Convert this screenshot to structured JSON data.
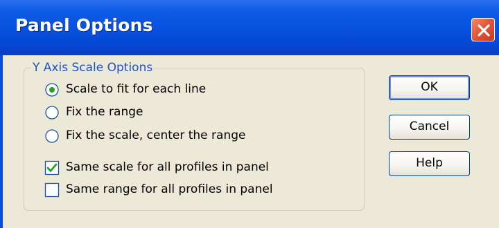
{
  "window": {
    "title": "Panel Options",
    "close_icon": "close-icon",
    "colors": {
      "titlebar": "#0449d8",
      "close": "#e2583a",
      "face": "#ece9d8",
      "group_label": "#1c51c9"
    }
  },
  "group": {
    "label": "Y Axis Scale Options",
    "radios": [
      {
        "label": "Scale to fit for each line",
        "selected": true
      },
      {
        "label": "Fix the range",
        "selected": false
      },
      {
        "label": "Fix the scale, center the range",
        "selected": false
      }
    ],
    "checkboxes": [
      {
        "label": "Same scale for all profiles in panel",
        "checked": true
      },
      {
        "label": "Same range for all profiles in panel",
        "checked": false
      }
    ]
  },
  "buttons": {
    "ok": "OK",
    "cancel": "Cancel",
    "help": "Help"
  }
}
